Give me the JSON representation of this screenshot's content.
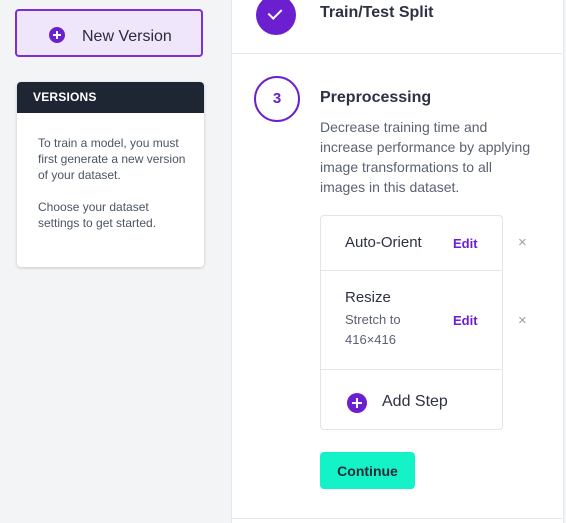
{
  "sidebar": {
    "new_version_label": "New Version",
    "versions_header": "VERSIONS",
    "versions_text_1": "To train a model, you must first generate a new version of your dataset.",
    "versions_text_2": "Choose your dataset settings to get started."
  },
  "steps": {
    "train_test_split": {
      "title": "Train/Test Split",
      "icon": "check-icon"
    },
    "preprocessing": {
      "number": "3",
      "title": "Preprocessing",
      "description": "Decrease training time and increase performance by applying image transformations to all images in this dataset.",
      "items": [
        {
          "label": "Auto-Orient",
          "edit": "Edit",
          "remove": "×"
        },
        {
          "label": "Resize",
          "sub": "Stretch to 416×416",
          "edit": "Edit",
          "remove": "×"
        }
      ],
      "add_step_label": "Add Step",
      "continue_label": "Continue"
    }
  },
  "colors": {
    "accent": "#6b1fcf",
    "continue_button": "#14f2c8",
    "versions_header_bg": "#1e2533",
    "new_version_bg": "#efe6fb"
  }
}
